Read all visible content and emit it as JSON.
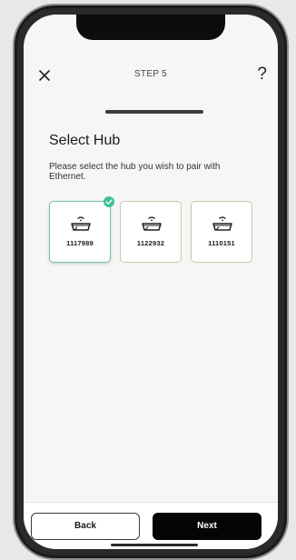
{
  "header": {
    "close_icon": "close-icon",
    "step_label": "STEP 5",
    "help_label": "?"
  },
  "progress": {
    "fraction": 1.0
  },
  "content": {
    "title": "Select Hub",
    "description": "Please select the hub you wish to pair with Ethernet."
  },
  "hubs": [
    {
      "id": "1117989",
      "selected": true,
      "icon": "hub-wifi-icon"
    },
    {
      "id": "1122932",
      "selected": false,
      "icon": "hub-wifi-icon"
    },
    {
      "id": "1110151",
      "selected": false,
      "icon": "hub-wifi-icon"
    }
  ],
  "footer": {
    "back_label": "Back",
    "next_label": "Next"
  },
  "colors": {
    "selected_border": "#6fc7b0",
    "check_badge": "#3fbf98",
    "card_border": "#d2c4a8",
    "primary_button": "#050505"
  }
}
